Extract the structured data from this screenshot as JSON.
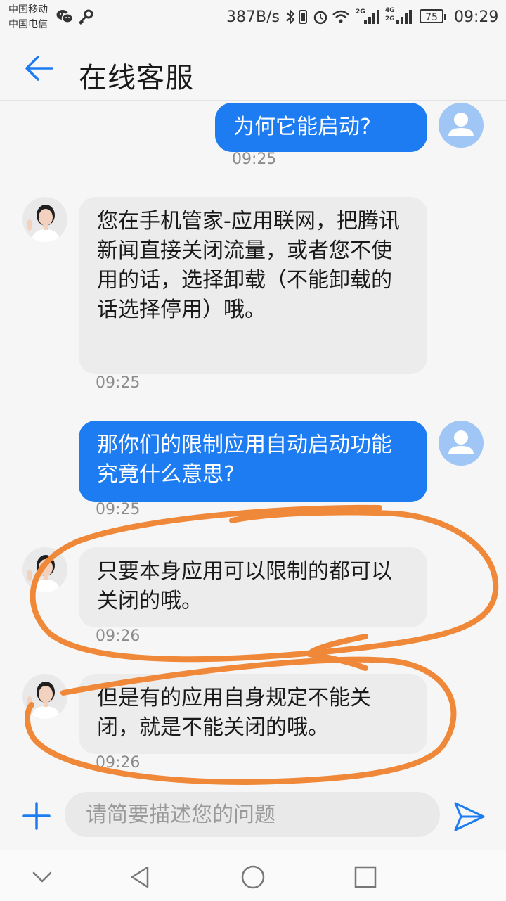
{
  "status_bar": {
    "carrier_1": "中国移动",
    "carrier_2": "中国电信",
    "net_speed": "387B/s",
    "signal_1_label": "2G",
    "signal_2_label_a": "4G",
    "signal_2_label_b": "2G",
    "battery": "75",
    "time": "09:29"
  },
  "header": {
    "title": "在线客服"
  },
  "messages": [
    {
      "sender": "user",
      "text": "为何它能启动?",
      "time": "09:25"
    },
    {
      "sender": "agent",
      "text": "您在手机管家-应用联网，把腾讯新闻直接关闭流量，或者您不使用的话，选择卸载（不能卸载的话选择停用）哦。",
      "time": "09:25"
    },
    {
      "sender": "user",
      "text": "那你们的限制应用自动启动功能究竟什么意思?",
      "time": "09:25"
    },
    {
      "sender": "agent",
      "text": "只要本身应用可以限制的都可以关闭的哦。",
      "time": "09:26"
    },
    {
      "sender": "agent",
      "text": "但是有的应用自身规定不能关闭，就是不能关闭的哦。",
      "time": "09:26"
    }
  ],
  "composer": {
    "placeholder": "请简要描述您的问题",
    "value": ""
  },
  "colors": {
    "accent": "#1d7cf2",
    "user_bubble": "#1d7cf2",
    "agent_bubble": "#ececec",
    "annotation": "#f0883a",
    "avatar_user_bg": "#9fc6f4"
  },
  "icons": {
    "back": "arrow-left-icon",
    "plus": "plus-icon",
    "send": "send-icon",
    "nav_back": "triangle-back-icon",
    "nav_home": "circle-home-icon",
    "nav_recents": "square-recents-icon",
    "nav_collapse": "chevron-down-icon"
  }
}
